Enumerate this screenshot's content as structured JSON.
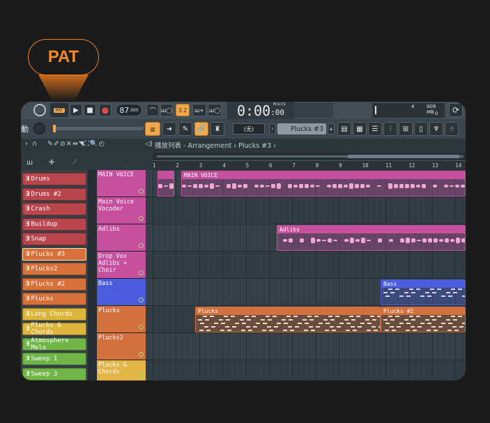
{
  "badge": {
    "label": "PAT"
  },
  "toolbar": {
    "pat_label": "PAT",
    "tempo_int": "87",
    "tempo_dec": ".000",
    "time_main": "0:00",
    "time_small": ":00",
    "time_unit": "M:S:CS",
    "snap_value": "3.2",
    "cpu_value": "4",
    "mem_value": "909 MB",
    "mem_sub": "0",
    "left_clip_text": "動",
    "pattern_selector": "Plucks #3",
    "snap_selector": "(无)"
  },
  "breadcrumb": {
    "prefix": "播放列表",
    "sep1": "-",
    "title": "Arrangement",
    "sep2": "›",
    "pattern": "Plucks #3",
    "arrow": "›"
  },
  "ruler": {
    "bars": [
      "1",
      "2",
      "3",
      "4",
      "5",
      "6",
      "7",
      "8",
      "9",
      "10",
      "11",
      "12",
      "13",
      "14"
    ]
  },
  "channels": [
    {
      "name": "Drums",
      "color": "#b9464c"
    },
    {
      "name": "Drums #2",
      "color": "#b9464c"
    },
    {
      "name": "Crash",
      "color": "#b9464c"
    },
    {
      "name": "Buildup",
      "color": "#b9464c"
    },
    {
      "name": "Snap",
      "color": "#b9464c"
    },
    {
      "name": "Plucks #3",
      "color": "#d8703a"
    },
    {
      "name": "Plucks2",
      "color": "#d8703a"
    },
    {
      "name": "Plucks #2",
      "color": "#d8703a"
    },
    {
      "name": "Plucks",
      "color": "#d8703a"
    },
    {
      "name": "Long Chords",
      "color": "#dcb53a"
    },
    {
      "name": "Plucks & Chords",
      "color": "#dcb53a"
    },
    {
      "name": "Atmosphere Melo",
      "color": "#6fb547"
    },
    {
      "name": "Sweep 1",
      "color": "#6fb547"
    },
    {
      "name": "Sweep 3",
      "color": "#6fb547"
    }
  ],
  "tracks": [
    {
      "name": "MAIN VOICE",
      "color": "#c64f9e"
    },
    {
      "name": "Main Voice Vocoder",
      "color": "#c64f9e"
    },
    {
      "name": "Adlibs",
      "color": "#c64f9e"
    },
    {
      "name": "Drop Vox Adlibs + Choir",
      "color": "#c64f9e"
    },
    {
      "name": "Bass",
      "color": "#4b5ddc"
    },
    {
      "name": "Plucks",
      "color": "#d2703e"
    },
    {
      "name": "Plucks2",
      "color": "#d2703e"
    },
    {
      "name": "Plucks & Chords",
      "color": "#e3b446"
    }
  ],
  "clips": [
    {
      "label": "",
      "color": "#c64f9e"
    },
    {
      "label": "MAIN VOICE",
      "color": "#c64f9e"
    },
    {
      "label": "Adlibs",
      "color": "#c64f9e"
    },
    {
      "label": "Bass",
      "color": "#4b5ddc"
    },
    {
      "label": "Plucks",
      "color": "#d2703e"
    },
    {
      "label": "Plucks #2",
      "color": "#d2703e"
    }
  ]
}
